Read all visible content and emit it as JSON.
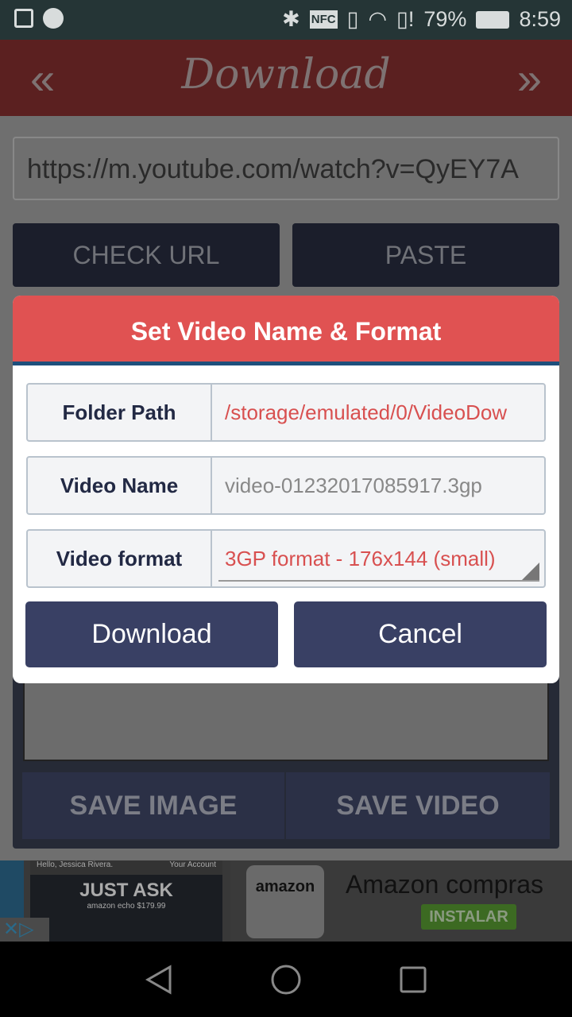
{
  "status": {
    "battery": "79%",
    "time": "8:59",
    "icons": [
      "image-icon",
      "play-icon",
      "bluetooth-icon",
      "nfc-icon",
      "vibrate-icon",
      "wifi-icon",
      "sim-alert-icon",
      "battery-icon"
    ]
  },
  "appbar": {
    "title": "Download",
    "prev": "«",
    "next": "»"
  },
  "url": {
    "value": "https://m.youtube.com/watch?v=QyEY7A"
  },
  "buttons": {
    "check_url": "CHECK URL",
    "paste": "PASTE",
    "save_image": "SAVE IMAGE",
    "save_video": "SAVE VIDEO"
  },
  "dialog": {
    "title": "Set Video Name & Format",
    "rows": [
      {
        "label": "Folder Path",
        "value": "/storage/emulated/0/VideoDow"
      },
      {
        "label": "Video Name",
        "value": "video-01232017085917.3gp"
      },
      {
        "label": "Video format",
        "value": "3GP format -  176x144 (small)"
      }
    ],
    "download": "Download",
    "cancel": "Cancel"
  },
  "ad": {
    "greeting": "Hello, Jessica Rivera.",
    "account": "Your Account",
    "headline": "JUST ASK",
    "product": "amazon echo",
    "price": "$179.99",
    "brand": "amazon",
    "app_name": "Amazon compras",
    "install": "INSTALAR"
  },
  "colors": {
    "dialog_header": "#e05252",
    "button": "#394064",
    "accent_text": "#d85050"
  }
}
